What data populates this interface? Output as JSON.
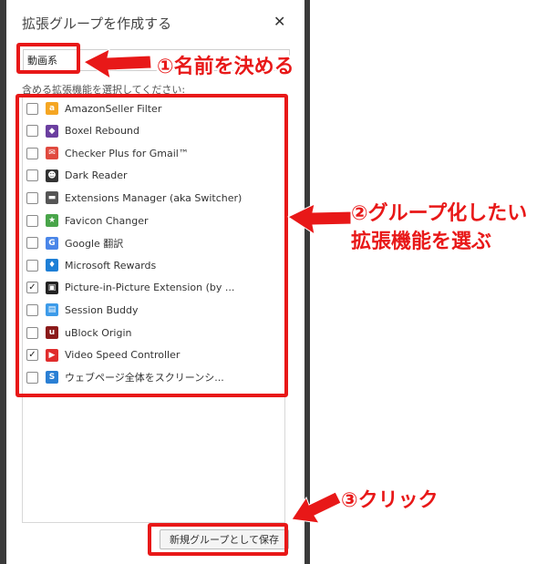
{
  "dialog": {
    "title": "拡張グループを作成する",
    "close_label": "✕",
    "name_value": "動画系",
    "select_label": "含める拡張機能を選択してください:",
    "save_label": "新規グループとして保存"
  },
  "extensions": [
    {
      "name": "AmazonSeller Filter",
      "checked": false,
      "icon": "amazon-icon",
      "color": "#f5a623",
      "glyph": "a"
    },
    {
      "name": "Boxel Rebound",
      "checked": false,
      "icon": "boxel-icon",
      "color": "#6b3fa0",
      "glyph": "◆"
    },
    {
      "name": "Checker Plus for Gmail™",
      "checked": false,
      "icon": "gmail-checker-icon",
      "color": "#e04a3f",
      "glyph": "✉"
    },
    {
      "name": "Dark Reader",
      "checked": false,
      "icon": "dark-reader-icon",
      "color": "#333333",
      "glyph": "☻"
    },
    {
      "name": "Extensions Manager (aka Switcher)",
      "checked": false,
      "icon": "extensions-manager-icon",
      "color": "#555555",
      "glyph": "▬"
    },
    {
      "name": "Favicon Changer",
      "checked": false,
      "icon": "favicon-changer-icon",
      "color": "#49a54a",
      "glyph": "★"
    },
    {
      "name": "Google 翻訳",
      "checked": false,
      "icon": "google-translate-icon",
      "color": "#4a86e8",
      "glyph": "G"
    },
    {
      "name": "Microsoft Rewards",
      "checked": false,
      "icon": "microsoft-rewards-icon",
      "color": "#1e7fd6",
      "glyph": "♦"
    },
    {
      "name": "Picture-in-Picture Extension (by ...",
      "checked": true,
      "icon": "pip-icon",
      "color": "#222222",
      "glyph": "▣"
    },
    {
      "name": "Session Buddy",
      "checked": false,
      "icon": "session-buddy-icon",
      "color": "#3d9be9",
      "glyph": "▤"
    },
    {
      "name": "uBlock Origin",
      "checked": false,
      "icon": "ublock-icon",
      "color": "#8b1a1a",
      "glyph": "u"
    },
    {
      "name": "Video Speed Controller",
      "checked": true,
      "icon": "video-speed-icon",
      "color": "#e02d2d",
      "glyph": "▶"
    },
    {
      "name": "ウェブページ全体をスクリーンシ...",
      "checked": false,
      "icon": "screenshot-icon",
      "color": "#2a7fd4",
      "glyph": "S"
    }
  ],
  "annotations": {
    "step1": "①名前を決める",
    "step2_line1": "②グループ化したい",
    "step2_line2": "拡張機能を選ぶ",
    "step3": "③クリック",
    "color": "#e81818"
  }
}
